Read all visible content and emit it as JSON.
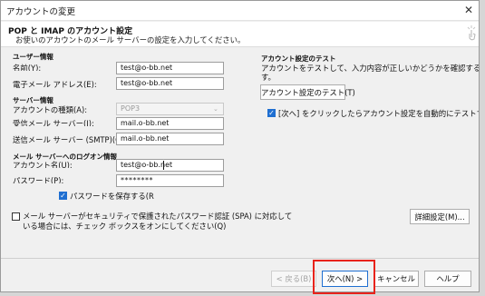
{
  "window": {
    "title": "アカウントの変更",
    "close_glyph": "✕"
  },
  "header": {
    "title": "POP と IMAP のアカウント設定",
    "subtitle": "お使いのアカウントのメール サーバーの設定を入力してください。"
  },
  "user_info": {
    "section": "ユーザー情報",
    "name_label": "名前(Y):",
    "name_value": "test@o-bb.net",
    "email_label": "電子メール アドレス(E):",
    "email_value": "test@o-bb.net"
  },
  "server_info": {
    "section": "サーバー情報",
    "account_type_label": "アカウントの種類(A):",
    "account_type_value": "POP3",
    "incoming_label": "受信メール サーバー(I):",
    "incoming_value": "mail.o-bb.net",
    "outgoing_label": "送信メール サーバー (SMTP)(O):",
    "outgoing_value": "mail.o-bb.net"
  },
  "logon_info": {
    "section": "メール サーバーへのログオン情報",
    "account_label": "アカウント名(U):",
    "account_value": "test@o-bb.net",
    "password_label": "パスワード(P):",
    "password_value": "********",
    "remember_label": "パスワードを保存する(R",
    "remember_checked": true
  },
  "spa": {
    "label_line1": "メール サーバーがセキュリティで保護されたパスワード認証 (SPA) に対応して",
    "label_line2": "いる場合には、チェック ボックスをオンにしてください(Q)",
    "checked": false
  },
  "test_settings": {
    "section": "アカウント設定のテスト",
    "desc_line1": "アカウントをテストして、入力内容が正しいかどうかを確認することをお勧めしま",
    "desc_line2": "す。",
    "test_button": "アカウント設定のテスト(T)",
    "auto_test_line1": "[次へ] をクリックしたらアカウント設定を自動的にテストする",
    "auto_test_checked": true
  },
  "buttons": {
    "details": "詳細設定(M)...",
    "back": "< 戻る(B)",
    "next": "次へ(N) >",
    "cancel": "キャンセル",
    "help": "ヘルプ"
  },
  "colors": {
    "highlight": "#e8231b",
    "checkbox_accent": "#1f6fd1"
  },
  "icons": {
    "checkmark": "✓",
    "dropdown": "⌄"
  }
}
